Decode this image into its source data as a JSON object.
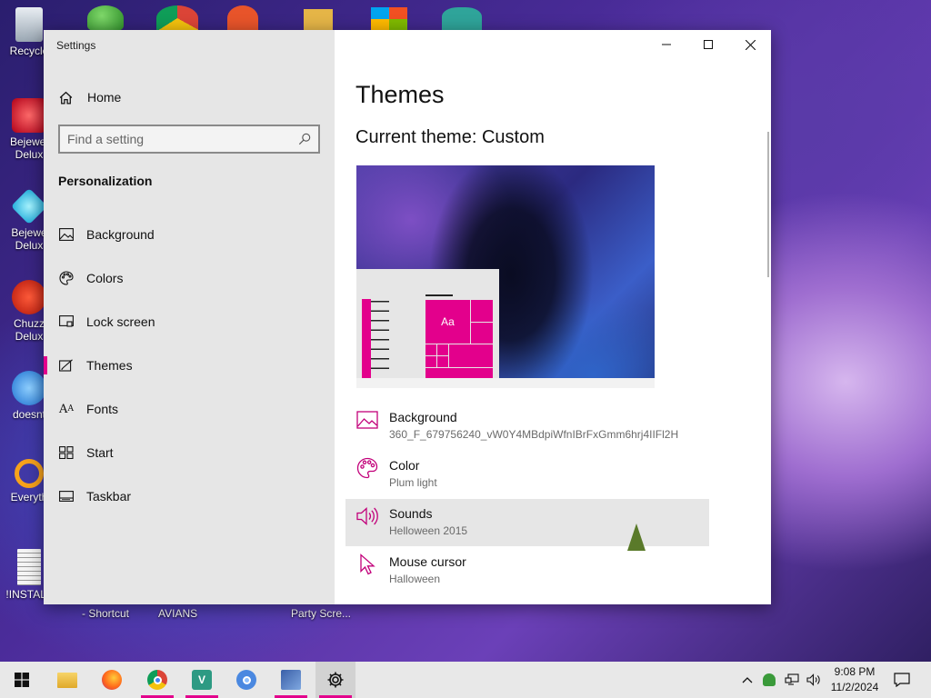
{
  "desktop": {
    "icons_left": [
      "Recycle",
      "Bejewel Delux",
      "Bejewe Delux",
      "Chuzz Delux",
      "doesnt",
      "Everyth",
      "!INSTALL"
    ],
    "bottom_labels": [
      "- Shortcut",
      "AVIANS",
      "Party Scre..."
    ]
  },
  "window": {
    "title": "Settings",
    "home_label": "Home",
    "search_placeholder": "Find a setting",
    "section_title": "Personalization",
    "nav_items": [
      {
        "label": "Background",
        "icon": "picture-icon"
      },
      {
        "label": "Colors",
        "icon": "palette-icon"
      },
      {
        "label": "Lock screen",
        "icon": "lock-screen-icon"
      },
      {
        "label": "Themes",
        "icon": "themes-icon"
      },
      {
        "label": "Fonts",
        "icon": "fonts-icon"
      },
      {
        "label": "Start",
        "icon": "start-icon"
      },
      {
        "label": "Taskbar",
        "icon": "taskbar-icon"
      }
    ],
    "active_nav": "Themes"
  },
  "main": {
    "page_title": "Themes",
    "current_theme": "Current theme: Custom",
    "preview_sample_text": "Aa",
    "settings": [
      {
        "title": "Background",
        "value": "360_F_679756240_vW0Y4MBdpiWfnIBrFxGmm6hrj4IIFl2H",
        "icon": "picture-icon"
      },
      {
        "title": "Color",
        "value": "Plum light",
        "icon": "palette-icon"
      },
      {
        "title": "Sounds",
        "value": "Helloween 2015",
        "icon": "speaker-icon"
      },
      {
        "title": "Mouse cursor",
        "value": "Halloween",
        "icon": "cursor-icon"
      }
    ],
    "hovered_setting": "Sounds"
  },
  "taskbar": {
    "apps": [
      "start",
      "file-explorer",
      "firefox",
      "chrome",
      "vs-app",
      "chromium",
      "screen-app",
      "settings"
    ],
    "time": "9:08 PM",
    "date": "11/2/2024"
  },
  "colors": {
    "accent": "#e3008c",
    "sidebar_bg": "#e6e6e6",
    "taskbar_bg": "#e8e8e8"
  }
}
